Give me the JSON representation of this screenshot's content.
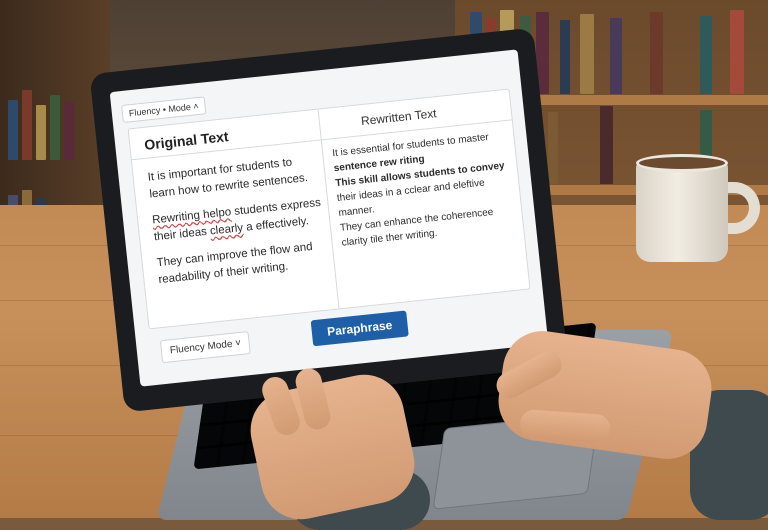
{
  "screen": {
    "top_mode_chip": "Fluency • Mode ˄",
    "original": {
      "title": "Original Text",
      "p1": "It is important for students to learn how to rewrite sentences.",
      "p2_misspelled": "Rewriting helpo",
      "p2_rest_a": " students express their ideas ",
      "p2_misspelled_2": "clearly",
      "p2_rest_b": " a effectively.",
      "p3": "They can improve the flow and readability of their writing."
    },
    "rewritten": {
      "title": "Rewritten Text",
      "line1": "It is essential for students to master",
      "line2": "sentence rew riting",
      "line3": "This skill allows students to convey",
      "line4": "their ideas in a cclear and eleftive",
      "line5": "manner.",
      "line6": "They can enhance the coherencee",
      "line7": "clarity tile ther writing."
    },
    "bottom_select": "Fluency Mode ˅",
    "paraphrase_label": "Paraphrase"
  },
  "colors": {
    "button": "#1f5fa8",
    "spellcheck": "#d04040"
  }
}
